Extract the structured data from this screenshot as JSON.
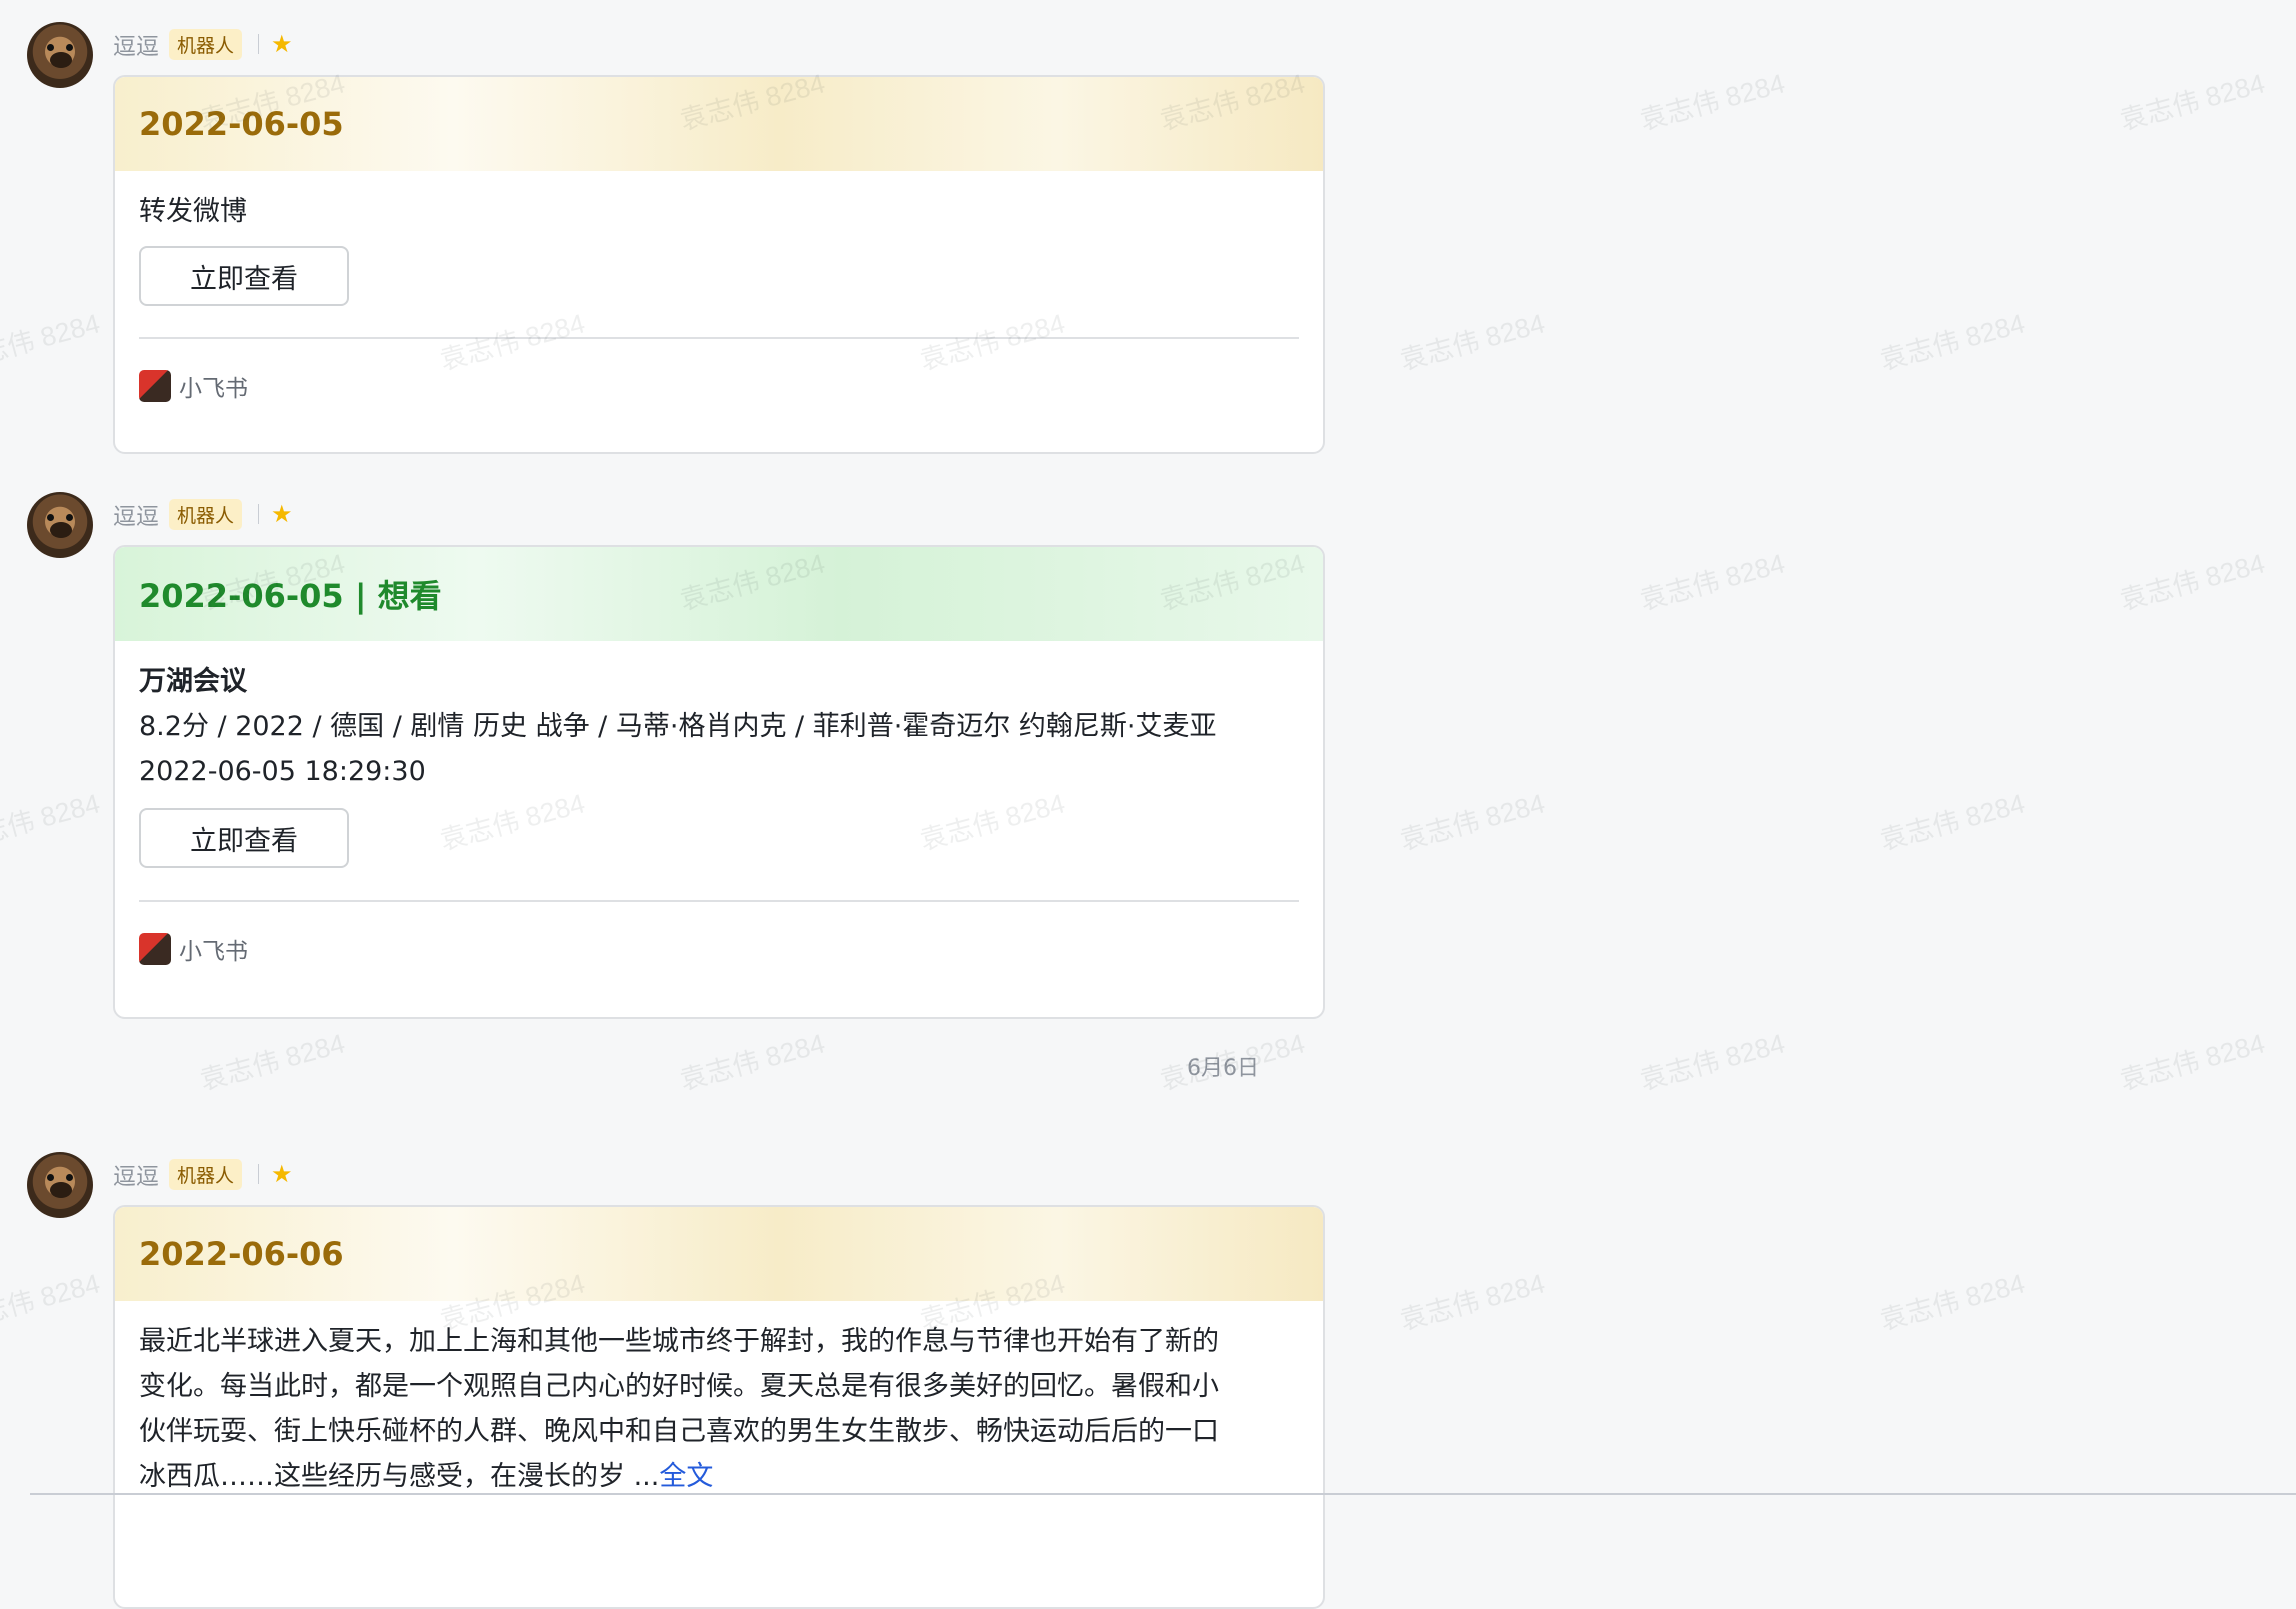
{
  "watermark": "袁志伟 8284",
  "messages": [
    {
      "sender": "逗逗",
      "badge": "机器人",
      "title": "2022-06-05",
      "body_line": "转发微博",
      "button": "立即查看",
      "app_name": "小飞书"
    },
    {
      "sender": "逗逗",
      "badge": "机器人",
      "title": "2022-06-05 | 想看",
      "movie_title": "万湖会议",
      "movie_info": "8.2分 / 2022 / 德国 / 剧情 历史 战争 / 马蒂·格肖内克 / 菲利普·霍奇迈尔 约翰尼斯·艾麦亚",
      "timestamp": "2022-06-05 18:29:30",
      "button": "立即查看",
      "app_name": "小飞书"
    },
    {
      "sender": "逗逗",
      "badge": "机器人",
      "title": "2022-06-06",
      "lines": [
        "最近北半球进入夏天，加上上海和其他一些城市终于解封，我的作息与节律也开始有了新的",
        "变化。每当此时，都是一个观照自己内心的好时候。夏天总是有很多美好的回忆。暑假和小",
        "伙伴玩耍、街上快乐碰杯的人群、晚风中和自己喜欢的男生女生散步、畅快运动后后的一口"
      ],
      "last_line": "冰西瓜……这些经历与感受，在漫长的岁 ...",
      "full_text_link": "全文"
    }
  ],
  "date_separator": "6月6日"
}
